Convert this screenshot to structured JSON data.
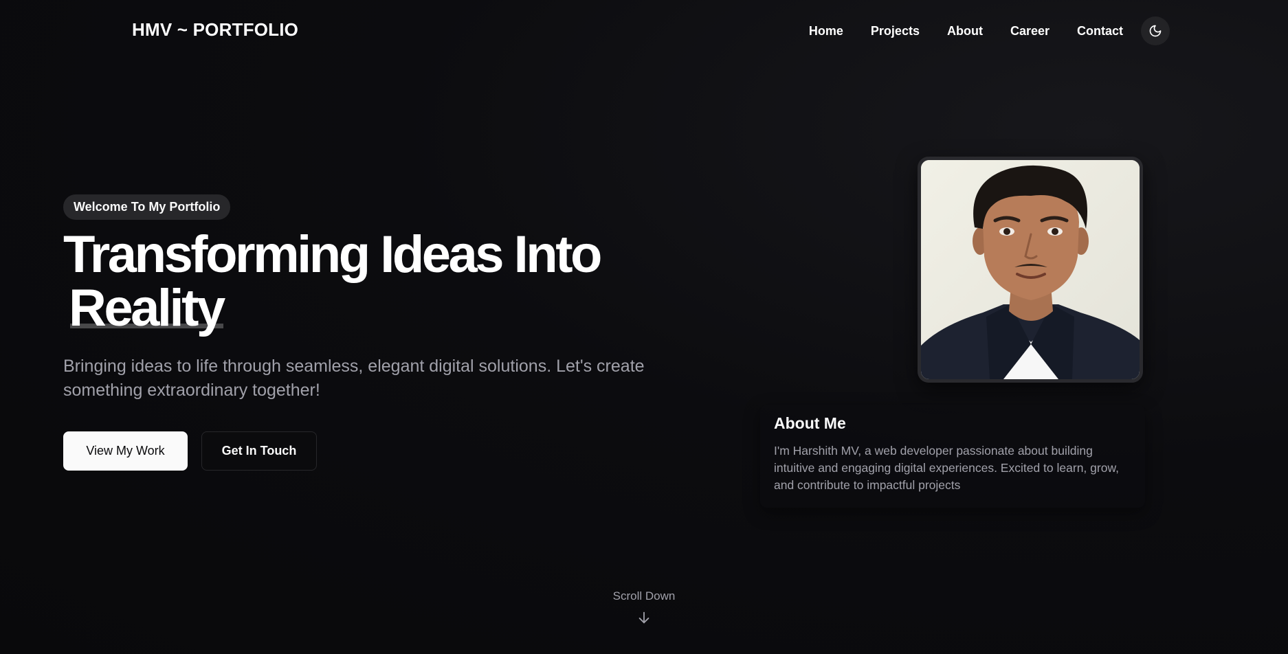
{
  "header": {
    "brand": "HMV ~ PORTFOLIO",
    "nav": [
      {
        "label": "Home"
      },
      {
        "label": "Projects"
      },
      {
        "label": "About"
      },
      {
        "label": "Career"
      },
      {
        "label": "Contact"
      }
    ],
    "theme_toggle_icon": "moon-icon"
  },
  "hero": {
    "badge": "Welcome To My Portfolio",
    "headline_line1": "Transforming Ideas Into",
    "headline_line2": "Reality",
    "subtitle": "Bringing ideas to life through seamless, elegant digital solutions. Let's create something extraordinary together!",
    "primary_button": "View My Work",
    "secondary_button": "Get In Touch"
  },
  "about": {
    "title": "About Me",
    "text": "I'm Harshith MV, a web developer passionate about building intuitive and engaging digital experiences. Excited to learn, grow, and contribute to impactful projects"
  },
  "scroll": {
    "label": "Scroll Down",
    "icon": "arrow-down-icon"
  },
  "colors": {
    "background": "#09090b",
    "text": "#fafafa",
    "muted": "#a1a1aa",
    "badge_bg": "#27272a"
  }
}
